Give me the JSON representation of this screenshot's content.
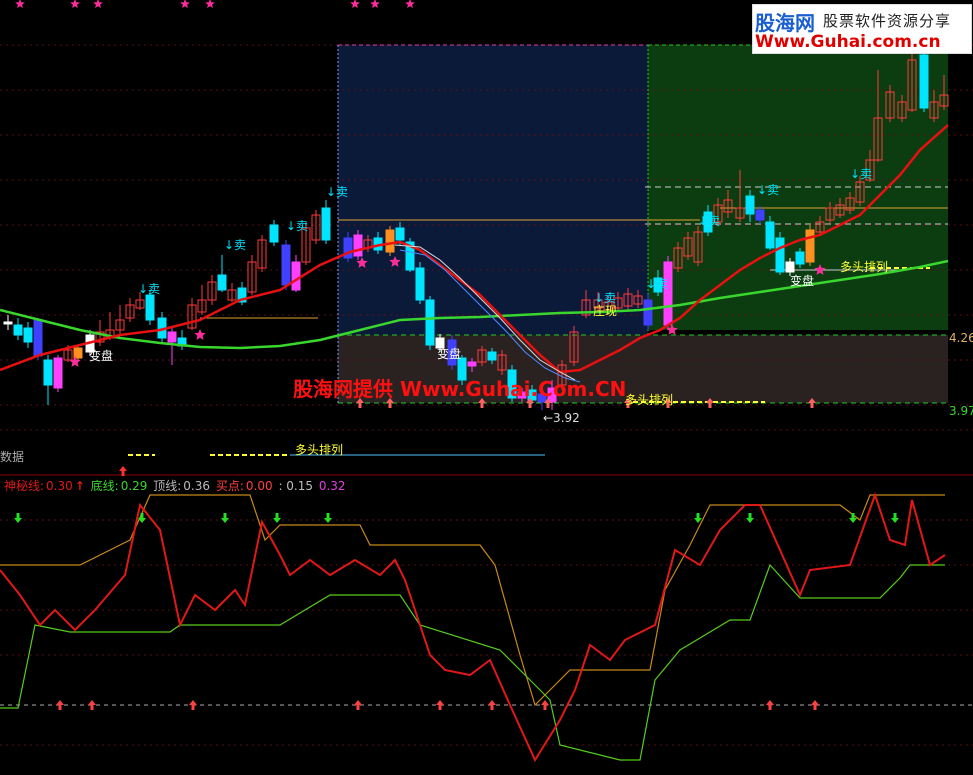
{
  "logo": {
    "brand": "股海网",
    "slogan": "股票软件资源分享",
    "url": "Www.Guhai.com.cn"
  },
  "watermark": "股海网提供 Www.Guhai.Com.CN",
  "price_labels": {
    "upper": "4.26",
    "lower": "3.97",
    "low_point": "←3.92"
  },
  "section_label": "数据",
  "annotations": {
    "sell": "↓卖",
    "change": "变盘",
    "bull": "多头排列",
    "zhuang": "庄现"
  },
  "indicator_legend": {
    "shenmi_label": "神秘线:",
    "shenmi_value": "0.30",
    "dixian_label": "底线:",
    "dixian_value": "0.29",
    "dingxian_label": "顶线:",
    "dingxian_value": "0.36",
    "maidian_label": "买点:",
    "maidian_value": "0.00",
    "extra1": ": 0.15",
    "extra2": "0.32"
  },
  "colors": {
    "bg": "#000000",
    "up_candle": "#ff3b3b",
    "down_candle": "#00e5ff",
    "ma_red": "#e81010",
    "ma_green": "#39d62e",
    "sell_text": "#00e5ff",
    "change_text": "#ffffff",
    "bull_text": "#ffff33",
    "star": "#ff2d9b",
    "blue_zone": "#0c1a3a",
    "green_zone": "#0b3d10",
    "brown_zone": "#2a2220",
    "osc_red": "#e01818",
    "osc_green": "#56cc1e",
    "osc_orange": "#c78a18",
    "arrow_green": "#22e022"
  }
}
